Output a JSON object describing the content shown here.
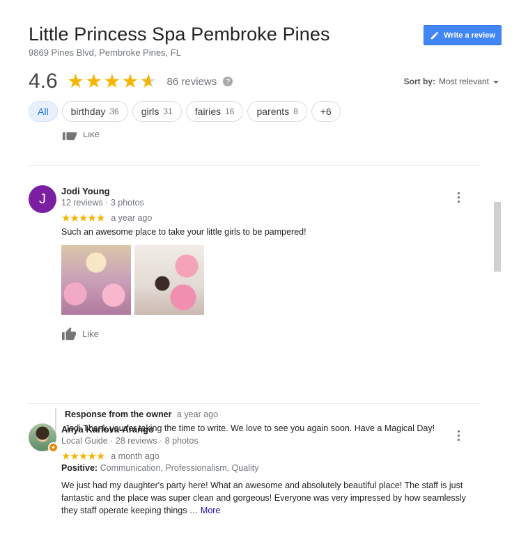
{
  "business": {
    "name": "Little Princess Spa Pembroke Pines",
    "address": "9869 Pines Blvd, Pembroke Pines, FL",
    "rating": "4.6",
    "review_count": "86 reviews",
    "help_glyph": "?"
  },
  "write_review_label": "Write a review",
  "sort": {
    "label": "Sort by:",
    "value": "Most relevant"
  },
  "chips": [
    {
      "label": "All",
      "count": ""
    },
    {
      "label": "birthday",
      "count": "36"
    },
    {
      "label": "girls",
      "count": "31"
    },
    {
      "label": "fairies",
      "count": "16"
    },
    {
      "label": "parents",
      "count": "8"
    },
    {
      "label": "+6",
      "count": ""
    }
  ],
  "like_label": "Like",
  "reviews": [
    {
      "avatar_letter": "J",
      "name": "Jodi Young",
      "meta": "12 reviews · 3 photos",
      "stars": "★★★★★",
      "time": "a year ago",
      "text": "Such an awesome place to take your little girls to be pampered!",
      "owner_response": {
        "title": "Response from the owner",
        "time": "a year ago",
        "text": "Jodi Thank you for taking the time to write. We love to see you again soon. Have a Magical Day!"
      }
    },
    {
      "name": "Anya Karlova-Arango",
      "meta": "Local Guide · 28 reviews · 8 photos",
      "stars": "★★★★★",
      "time": "a month ago",
      "positive_label": "Positive:",
      "positive_value": "Communication, Professionalism, Quality",
      "text": "We just had my daughter's party here! What an awesome and absolutely beautiful place! The staff is just fantastic and the place was super clean and gorgeous!  Everyone was very impressed by how seamlessly they staff operate keeping things … ",
      "more_label": "More"
    }
  ],
  "colors": {
    "star": "#f5b400",
    "button": "#4285f4",
    "chip_active_bg": "#e8f0fe",
    "chip_active_text": "#1a73e8",
    "avatar_j": "#7b1fa2",
    "local_guide_badge": "#ea8600"
  }
}
